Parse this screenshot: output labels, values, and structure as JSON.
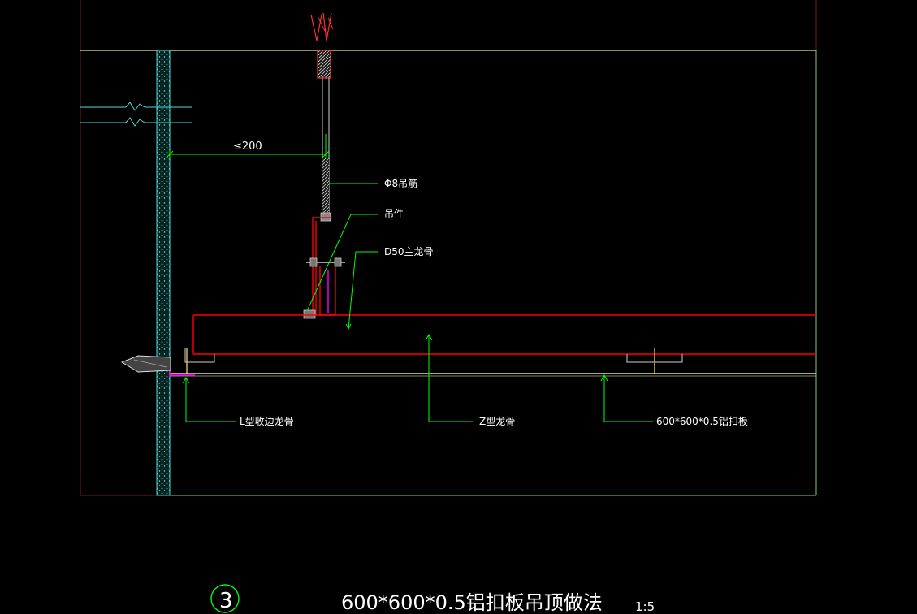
{
  "dimension": {
    "value": "≤200"
  },
  "labels": {
    "hanger_rod": "Φ8吊筋",
    "hanger": "吊件",
    "main_keel": "D50主龙骨",
    "l_edge_keel": "L型收边龙骨",
    "z_keel": "Z型龙骨",
    "panel": "600*600*0.5铝扣板"
  },
  "title": {
    "number": "3",
    "text": "600*600*0.5铝扣板吊顶做法",
    "scale": "1:5"
  },
  "colors": {
    "background": "#000000",
    "frame_dark_red": "#7a1a1a",
    "slab_yellow": "#e6e68a",
    "wall_hatch": "#4fd8d8",
    "leader_green": "#00ff00",
    "keel_red": "#ff0000",
    "magenta": "#ff00ff",
    "text": "#ffffff"
  }
}
